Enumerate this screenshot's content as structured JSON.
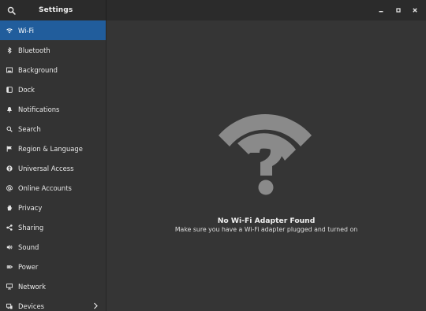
{
  "window": {
    "title": "Settings"
  },
  "sidebar": {
    "items": [
      {
        "label": "Wi-Fi",
        "icon": "wifi-icon",
        "active": true
      },
      {
        "label": "Bluetooth",
        "icon": "bluetooth-icon"
      },
      {
        "label": "Background",
        "icon": "background-icon"
      },
      {
        "label": "Dock",
        "icon": "dock-icon"
      },
      {
        "label": "Notifications",
        "icon": "bell-icon"
      },
      {
        "label": "Search",
        "icon": "search-icon"
      },
      {
        "label": "Region & Language",
        "icon": "flag-icon"
      },
      {
        "label": "Universal Access",
        "icon": "accessibility-icon"
      },
      {
        "label": "Online Accounts",
        "icon": "at-sign-icon"
      },
      {
        "label": "Privacy",
        "icon": "hand-icon"
      },
      {
        "label": "Sharing",
        "icon": "share-icon"
      },
      {
        "label": "Sound",
        "icon": "speaker-icon"
      },
      {
        "label": "Power",
        "icon": "power-icon"
      },
      {
        "label": "Network",
        "icon": "network-icon"
      },
      {
        "label": "Devices",
        "icon": "devices-icon",
        "has_submenu": true
      }
    ]
  },
  "content": {
    "title": "No Wi-Fi Adapter Found",
    "subtitle": "Make sure you have a Wi-Fi adapter plugged and turned on",
    "icon": "wifi-question-icon"
  },
  "colors": {
    "accent": "#215d9c",
    "background": "#353535",
    "sidebar": "#333333",
    "headerbar": "#2b2b2b",
    "icon_gray": "#8a8a8a"
  }
}
